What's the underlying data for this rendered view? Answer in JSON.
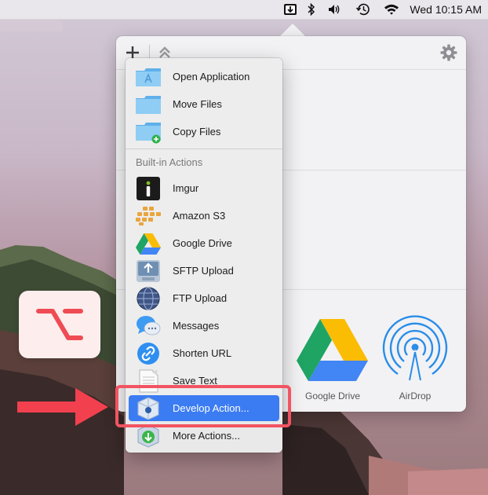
{
  "menubar": {
    "clock": "Wed 10:15 AM",
    "icons": [
      "dropzone-icon",
      "bluetooth-icon",
      "volume-icon",
      "time-machine-icon",
      "wifi-icon"
    ]
  },
  "popover": {
    "toolbar": {
      "add": "add-icon",
      "collapse": "chevrons-up-icon",
      "settings": "gear-icon"
    },
    "share_targets": [
      {
        "label": "Google Drive",
        "icon": "google-drive-icon"
      },
      {
        "label": "AirDrop",
        "icon": "airdrop-icon"
      }
    ]
  },
  "menu": {
    "items_top": [
      {
        "label": "Open Application",
        "icon": "app-folder-icon"
      },
      {
        "label": "Move Files",
        "icon": "folder-icon"
      },
      {
        "label": "Copy Files",
        "icon": "folder-copy-icon"
      }
    ],
    "section_header": "Built-in Actions",
    "items_builtin": [
      {
        "label": "Imgur",
        "icon": "imgur-icon"
      },
      {
        "label": "Amazon S3",
        "icon": "amazon-s3-icon"
      },
      {
        "label": "Google Drive",
        "icon": "google-drive-icon"
      },
      {
        "label": "SFTP Upload",
        "icon": "sftp-icon"
      },
      {
        "label": "FTP Upload",
        "icon": "ftp-globe-icon"
      },
      {
        "label": "Messages",
        "icon": "messages-icon"
      },
      {
        "label": "Shorten URL",
        "icon": "link-icon"
      },
      {
        "label": "Save Text",
        "icon": "text-file-icon"
      },
      {
        "label": "Develop Action...",
        "icon": "develop-action-icon",
        "selected": true
      },
      {
        "label": "More Actions...",
        "icon": "more-actions-icon"
      }
    ]
  },
  "colors": {
    "selection": "#3b7cf2",
    "highlight": "#f25462",
    "arrow": "#f2404f"
  }
}
